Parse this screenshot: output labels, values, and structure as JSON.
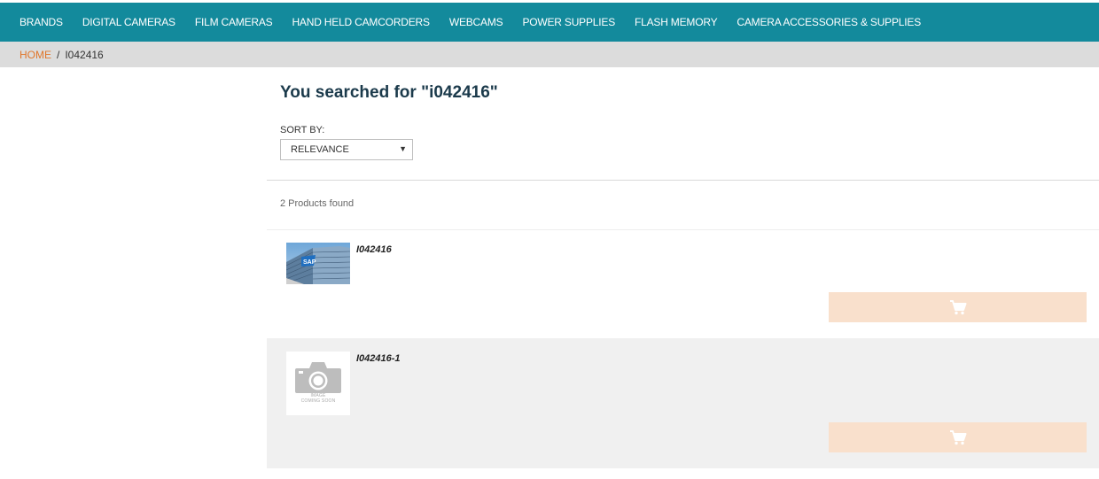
{
  "nav": {
    "items": [
      "BRANDS",
      "DIGITAL CAMERAS",
      "FILM CAMERAS",
      "HAND HELD CAMCORDERS",
      "WEBCAMS",
      "POWER SUPPLIES",
      "FLASH MEMORY",
      "CAMERA ACCESSORIES & SUPPLIES"
    ]
  },
  "breadcrumb": {
    "home": "HOME",
    "separator": "/",
    "current": "I042416"
  },
  "search": {
    "title": "You searched for \"i042416\"",
    "sort_label": "SORT BY:",
    "sort_value": "RELEVANCE",
    "count_text": "2 Products found"
  },
  "products": [
    {
      "name": "I042416",
      "image": "sap-building-photo",
      "cart_icon": "cart-icon"
    },
    {
      "name": "I042416-1",
      "image": "image-coming-soon",
      "placeholder_line1": "IMAGE",
      "placeholder_line2": "COMING SOON",
      "cart_icon": "cart-icon"
    }
  ],
  "colors": {
    "nav_bg": "#138a9c",
    "breadcrumb_bg": "#dcdcdc",
    "home_link": "#e0762b",
    "title": "#1b3a4b",
    "cart_button": "#f9e0cc",
    "alt_row": "#f0f0f0"
  }
}
